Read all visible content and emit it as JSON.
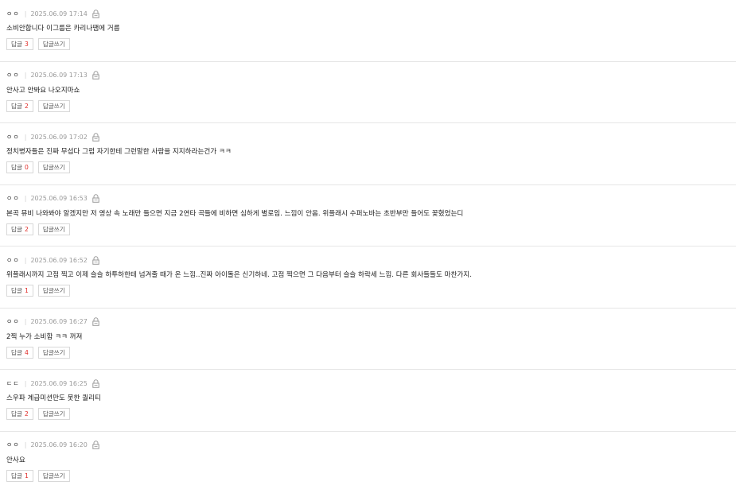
{
  "comments": [
    {
      "author": "ㅇㅇ",
      "date": "2025.06.09 17:14",
      "text": "소비안합니다 이그룹은 카리나땜에 거름",
      "reply_label": "답글",
      "reply_count": "3",
      "write_label": "답글쓰기"
    },
    {
      "author": "ㅇㅇ",
      "date": "2025.06.09 17:13",
      "text": "안사고 안봐요 나오지마쇼",
      "reply_label": "답글",
      "reply_count": "2",
      "write_label": "답글쓰기"
    },
    {
      "author": "ㅇㅇ",
      "date": "2025.06.09 17:02",
      "text": "정치병자들은 진짜 무섭다 그럼 자기한테 그런말한 사람을 지지하라는건가 ㅋㅋ",
      "reply_label": "답글",
      "reply_count": "0",
      "write_label": "답글쓰기"
    },
    {
      "author": "ㅇㅇ",
      "date": "2025.06.09 16:53",
      "text": "본곡 뮤비 나와봐야 알겠지만 저 영상 속 노래만 들으면 지금 2연타 곡들에 비하면 심하게 별로임. 느낌이 안옴. 위플래시 수퍼노바는 초반부만 들어도 꽂혔었는디",
      "reply_label": "답글",
      "reply_count": "2",
      "write_label": "답글쓰기"
    },
    {
      "author": "ㅇㅇ",
      "date": "2025.06.09 16:52",
      "text": "위플래시까지 고점 찍고 이제 슬슬 하투하한테 넘겨줄 때가 온 느낌..진짜 아이돌은 신기하네. 고점 찍으면 그 다음부터 슬슬 하락세 느낌. 다른 회사들들도 마찬가지.",
      "reply_label": "답글",
      "reply_count": "1",
      "write_label": "답글쓰기"
    },
    {
      "author": "ㅇㅇ",
      "date": "2025.06.09 16:27",
      "text": "2찍 누가 소비함 ㅋㅋ 꺼져",
      "reply_label": "답글",
      "reply_count": "4",
      "write_label": "답글쓰기"
    },
    {
      "author": "ㄷㄷ",
      "date": "2025.06.09 16:25",
      "text": "스우파 계급미션만도 못한 퀄리티",
      "reply_label": "답글",
      "reply_count": "2",
      "write_label": "답글쓰기"
    },
    {
      "author": "ㅇㅇ",
      "date": "2025.06.09 16:20",
      "text": "안사요",
      "reply_label": "답글",
      "reply_count": "1",
      "write_label": "답글쓰기"
    }
  ]
}
